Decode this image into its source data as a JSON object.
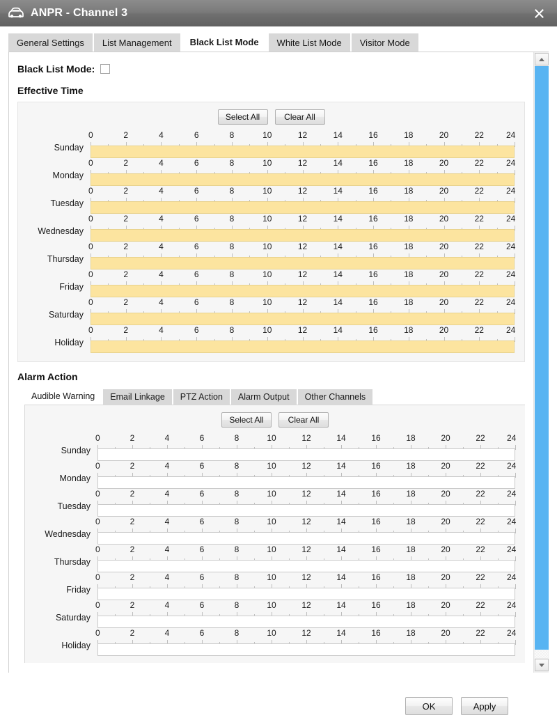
{
  "window": {
    "title": "ANPR - Channel 3",
    "app_icon": "car-icon",
    "close_icon": "close-icon"
  },
  "tabs": [
    {
      "label": "General Settings",
      "active": false
    },
    {
      "label": "List Management",
      "active": false
    },
    {
      "label": "Black List Mode",
      "active": true
    },
    {
      "label": "White List Mode",
      "active": false
    },
    {
      "label": "Visitor Mode",
      "active": false
    }
  ],
  "mode_toggle": {
    "label": "Black List Mode:",
    "checked": false
  },
  "effective_time": {
    "heading": "Effective Time",
    "select_all_label": "Select All",
    "clear_all_label": "Clear All",
    "axis_ticks": [
      "0",
      "2",
      "4",
      "6",
      "8",
      "10",
      "12",
      "14",
      "16",
      "18",
      "20",
      "22",
      "24"
    ],
    "axis_min": 0,
    "axis_max": 24,
    "rows": [
      {
        "day": "Sunday",
        "filled": true,
        "start": 0,
        "end": 24
      },
      {
        "day": "Monday",
        "filled": true,
        "start": 0,
        "end": 24
      },
      {
        "day": "Tuesday",
        "filled": true,
        "start": 0,
        "end": 24
      },
      {
        "day": "Wednesday",
        "filled": true,
        "start": 0,
        "end": 24
      },
      {
        "day": "Thursday",
        "filled": true,
        "start": 0,
        "end": 24
      },
      {
        "day": "Friday",
        "filled": true,
        "start": 0,
        "end": 24
      },
      {
        "day": "Saturday",
        "filled": true,
        "start": 0,
        "end": 24
      },
      {
        "day": "Holiday",
        "filled": true,
        "start": 0,
        "end": 24
      }
    ]
  },
  "alarm_action": {
    "heading": "Alarm Action",
    "tabs": [
      {
        "label": "Audible Warning",
        "active": true
      },
      {
        "label": "Email Linkage",
        "active": false
      },
      {
        "label": "PTZ Action",
        "active": false
      },
      {
        "label": "Alarm Output",
        "active": false
      },
      {
        "label": "Other Channels",
        "active": false
      }
    ],
    "select_all_label": "Select All",
    "clear_all_label": "Clear All",
    "axis_ticks": [
      "0",
      "2",
      "4",
      "6",
      "8",
      "10",
      "12",
      "14",
      "16",
      "18",
      "20",
      "22",
      "24"
    ],
    "axis_min": 0,
    "axis_max": 24,
    "rows": [
      {
        "day": "Sunday",
        "filled": false
      },
      {
        "day": "Monday",
        "filled": false
      },
      {
        "day": "Tuesday",
        "filled": false
      },
      {
        "day": "Wednesday",
        "filled": false
      },
      {
        "day": "Thursday",
        "filled": false
      },
      {
        "day": "Friday",
        "filled": false
      },
      {
        "day": "Saturday",
        "filled": false
      },
      {
        "day": "Holiday",
        "filled": false
      }
    ]
  },
  "footer": {
    "ok_label": "OK",
    "apply_label": "Apply"
  },
  "scrollbar": {
    "up_icon": "arrow-up-icon",
    "down_icon": "arrow-down-icon"
  },
  "colors": {
    "titlebar": "#7a7a7a",
    "filled_slot": "#fce49f",
    "scroll_thumb": "#58b4f2",
    "tab_inactive": "#d8d8d8",
    "panel_bg": "#f6f6f6"
  }
}
